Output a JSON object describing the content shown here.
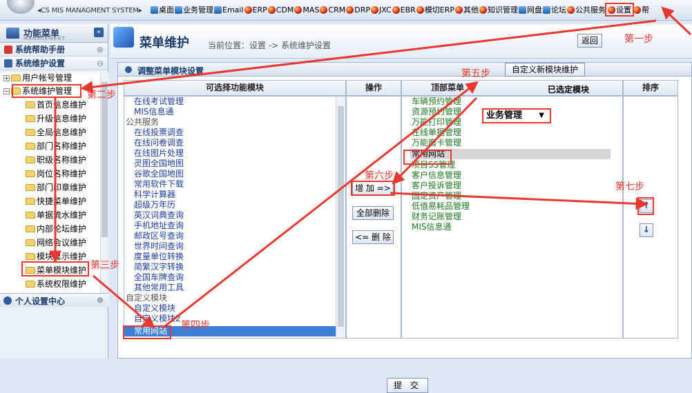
{
  "header": {
    "logo_sub": "◂CS MIS MANAGMENT SYSTEM▸",
    "nav": [
      {
        "label": "桌面",
        "icon": "monitor-icon"
      },
      {
        "label": "业务管理",
        "icon": "grid-icon"
      },
      {
        "label": "Email",
        "icon": "email-icon"
      },
      {
        "label": "ERP",
        "icon": "erp-icon"
      },
      {
        "label": "CDM",
        "icon": "cdm-icon"
      },
      {
        "label": "MAS",
        "icon": "mas-icon"
      },
      {
        "label": "CRM",
        "icon": "crm-icon"
      },
      {
        "label": "DRP",
        "icon": "drp-icon"
      },
      {
        "label": "JXC",
        "icon": "jxc-icon"
      },
      {
        "label": "EBR",
        "icon": "ebr-icon"
      },
      {
        "label": "模切ERP",
        "icon": "die-cut-erp-icon"
      },
      {
        "label": "其他",
        "icon": "other-icon"
      },
      {
        "label": "知识管理",
        "icon": "knowledge-icon"
      },
      {
        "label": "网盘",
        "icon": "netdisk-icon"
      },
      {
        "label": "论坛",
        "icon": "forum-icon"
      },
      {
        "label": "公共服务",
        "icon": "public-service-icon"
      },
      {
        "label": "设置",
        "icon": "settings-icon"
      },
      {
        "label": "帮",
        "icon": "help-icon"
      }
    ]
  },
  "sidebar": {
    "title": "功能菜单",
    "title_en": "MANAGEMENT",
    "collapse": "«",
    "groups": [
      "系统帮助手册",
      "系统维护设置"
    ],
    "expand_marks": [
      "⊕",
      "⊖"
    ],
    "tree_roots": [
      {
        "pm": "+",
        "label": "用户帐号管理"
      },
      {
        "pm": "−",
        "label": "系统维护管理"
      }
    ],
    "tree_children": [
      "首页信息维护",
      "升级信息维护",
      "全局信息维护",
      "部门名称维护",
      "职级名称维护",
      "岗位名称维护",
      "部门印章维护",
      "快捷菜单维护",
      "单据流水维护",
      "内部论坛维护",
      "网络会议维护",
      "模块显示维护",
      "菜单模块维护",
      "系统权限维护"
    ],
    "bottom_group": "个人设置中心",
    "bottom_mark": "⊕"
  },
  "main": {
    "title": "菜单维护",
    "breadcrumb": "当前位置：设置 -> 系统维护设置",
    "back": "返回",
    "panel_title": "调整菜单模块设置",
    "custom_module_btn": "自定义新模块维护",
    "col_available": "可选择功能模块",
    "col_ops": "操作",
    "col_top_menu": "顶部菜单",
    "col_selected": "已选定模块",
    "col_sort": "排序",
    "available": [
      {
        "text": "在线考试管理",
        "type": "sub"
      },
      {
        "text": "MIS信息通",
        "type": "sub"
      },
      {
        "text": "公共服务",
        "type": "cat"
      },
      {
        "text": "在线投票调查",
        "type": "sub"
      },
      {
        "text": "在线问卷调查",
        "type": "sub"
      },
      {
        "text": "在线图片处理",
        "type": "sub"
      },
      {
        "text": "灵图全国地图",
        "type": "sub"
      },
      {
        "text": "谷歌全国地图",
        "type": "sub"
      },
      {
        "text": "常用软件下载",
        "type": "sub"
      },
      {
        "text": "科学计算器",
        "type": "sub"
      },
      {
        "text": "超级万年历",
        "type": "sub"
      },
      {
        "text": "英汉词典查询",
        "type": "sub"
      },
      {
        "text": "手机地址查询",
        "type": "sub"
      },
      {
        "text": "邮政区号查询",
        "type": "sub"
      },
      {
        "text": "世界时间查询",
        "type": "sub"
      },
      {
        "text": "度量单位转换",
        "type": "sub"
      },
      {
        "text": "简繁汉字转换",
        "type": "sub"
      },
      {
        "text": "全国车牌查询",
        "type": "sub"
      },
      {
        "text": "其他常用工具",
        "type": "sub"
      },
      {
        "text": "自定义模块",
        "type": "cat"
      },
      {
        "text": "自定义模块",
        "type": "sub"
      },
      {
        "text": "自定义模块2",
        "type": "sub"
      },
      {
        "text": "常用网站",
        "type": "sel"
      }
    ],
    "ops": {
      "add": "增 加 =>",
      "delete_all": "全部删除",
      "delete": "<= 删 除"
    },
    "top_menu_value": "业务管理",
    "selected": [
      "车辆预约管理",
      "资源预约管理",
      "万能打印管理",
      "在线单据管理",
      "万能磨卡管理",
      "常用网站",
      "项目SS管理",
      "客户信息管理",
      "客户投诉管理",
      "固定资产管理",
      "低值易耗品管理",
      "财务记账管理",
      "MIS信息通"
    ],
    "sort_up": "↑",
    "sort_down": "↓",
    "submit": "提 交"
  },
  "annotations": {
    "steps": [
      "第一步",
      "第二步",
      "第三步",
      "第四步",
      "第五步",
      "第六步",
      "第七步"
    ],
    "color": "#e8382f"
  }
}
